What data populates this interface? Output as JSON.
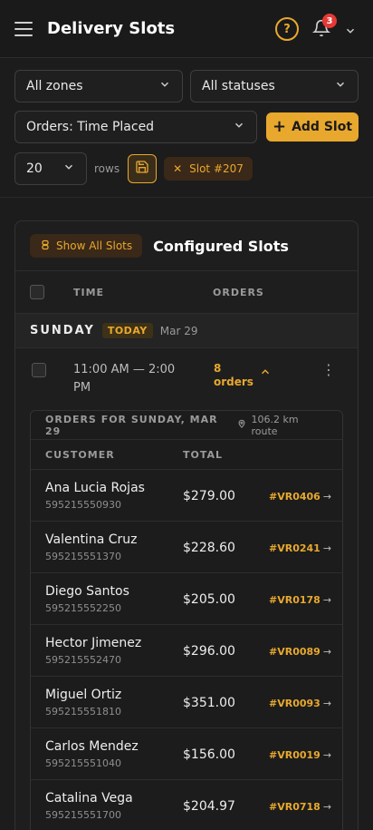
{
  "header": {
    "title": "Delivery Slots",
    "help_label": "?",
    "notification_count": "3"
  },
  "filters": {
    "zone": "All zones",
    "status": "All statuses",
    "sort": "Orders: Time Placed",
    "add_slot_label": "Add Slot",
    "rows_value": "20",
    "rows_label": "rows",
    "chip_label": "Slot #207"
  },
  "card": {
    "show_all_label": "Show All Slots",
    "title": "Configured Slots",
    "col_time": "TIME",
    "col_orders": "ORDERS",
    "day": {
      "name": "SUNDAY",
      "badge": "TODAY",
      "date": "Mar 29"
    },
    "slot": {
      "time": "11:00 AM — 2:00 PM",
      "orders_count": "8",
      "orders_word": "orders"
    },
    "panel": {
      "title": "ORDERS FOR SUNDAY, MAR 29",
      "route": "106.2 km route",
      "col_customer": "CUSTOMER",
      "col_total": "TOTAL",
      "orders": [
        {
          "name": "Ana Lucia Rojas",
          "phone": "595215550930",
          "total": "$279.00",
          "id": "#VR0406"
        },
        {
          "name": "Valentina Cruz",
          "phone": "595215551370",
          "total": "$228.60",
          "id": "#VR0241"
        },
        {
          "name": "Diego Santos",
          "phone": "595215552250",
          "total": "$205.00",
          "id": "#VR0178"
        },
        {
          "name": "Hector Jimenez",
          "phone": "595215552470",
          "total": "$296.00",
          "id": "#VR0089"
        },
        {
          "name": "Miguel Ortiz",
          "phone": "595215551810",
          "total": "$351.00",
          "id": "#VR0093"
        },
        {
          "name": "Carlos Mendez",
          "phone": "595215551040",
          "total": "$156.00",
          "id": "#VR0019"
        },
        {
          "name": "Catalina Vega",
          "phone": "595215551700",
          "total": "$204.97",
          "id": "#VR0718"
        }
      ]
    }
  },
  "colors": {
    "accent": "#e8a82e",
    "background": "#1c1c1c",
    "badge_red": "#e53935"
  },
  "icons": [
    "menu-icon",
    "help-icon",
    "bell-icon",
    "chevron-down-icon",
    "plus-icon",
    "save-icon",
    "close-icon",
    "slots-icon",
    "chevron-up-icon",
    "more-vertical-icon",
    "location-pin-icon",
    "arrow-right-icon"
  ]
}
